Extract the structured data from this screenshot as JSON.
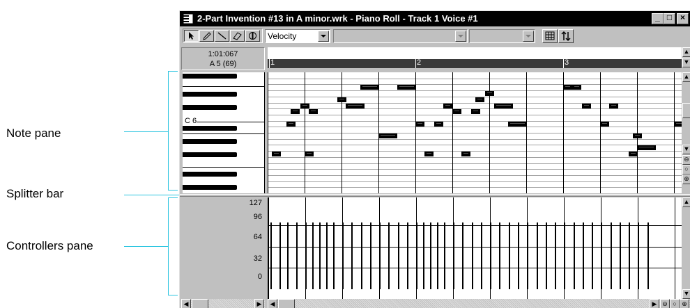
{
  "window": {
    "title": "2-Part Invention #13 in A minor.wrk - Piano Roll - Track 1 Voice #1",
    "min_glyph": "_",
    "max_glyph": "□",
    "close_glyph": "×"
  },
  "toolbar": {
    "tools": [
      "select-arrow-icon",
      "pencil-icon",
      "line-icon",
      "eraser-icon",
      "scrub-icon"
    ],
    "controller_select": "Velocity",
    "snap_icon": "grid-icon",
    "swap_icon": "arrows-updown-icon"
  },
  "position": {
    "time": "1:01:067",
    "pitch": "A 5 (69)"
  },
  "ruler": {
    "measures": [
      "1",
      "2",
      "3"
    ]
  },
  "keyboard": {
    "c_label": "C 6"
  },
  "controller_scale": [
    "127",
    "96",
    "64",
    "32",
    "0"
  ],
  "callouts": {
    "note_pane": "Note pane",
    "splitter_bar": "Splitter bar",
    "controllers_pane": "Controllers pane"
  },
  "colors": {
    "callout_line": "#29c4e0",
    "window_face": "#c0c0c0",
    "titlebar": "#000000",
    "ruler_bar": "#3a3a3a"
  },
  "notes": [
    {
      "start": 0.06,
      "len": 0.12,
      "row": 13
    },
    {
      "start": 0.31,
      "len": 0.12,
      "row": 6
    },
    {
      "start": 0.44,
      "len": 0.12,
      "row": 5
    },
    {
      "start": 0.56,
      "len": 0.12,
      "row": 6
    },
    {
      "start": 0.25,
      "len": 0.12,
      "row": 8
    },
    {
      "start": 0.5,
      "len": 0.12,
      "row": 13
    },
    {
      "start": 0.94,
      "len": 0.12,
      "row": 4
    },
    {
      "start": 1.25,
      "len": 0.25,
      "row": 2
    },
    {
      "start": 1.06,
      "len": 0.25,
      "row": 5
    },
    {
      "start": 1.5,
      "len": 0.25,
      "row": 10
    },
    {
      "start": 1.75,
      "len": 0.25,
      "row": 2
    },
    {
      "start": 2.0,
      "len": 0.12,
      "row": 8
    },
    {
      "start": 2.12,
      "len": 0.12,
      "row": 13
    },
    {
      "start": 2.25,
      "len": 0.12,
      "row": 8
    },
    {
      "start": 2.38,
      "len": 0.12,
      "row": 5
    },
    {
      "start": 2.5,
      "len": 0.12,
      "row": 6
    },
    {
      "start": 2.62,
      "len": 0.12,
      "row": 13
    },
    {
      "start": 2.75,
      "len": 0.12,
      "row": 6
    },
    {
      "start": 2.81,
      "len": 0.12,
      "row": 4
    },
    {
      "start": 2.94,
      "len": 0.12,
      "row": 3
    },
    {
      "start": 3.06,
      "len": 0.25,
      "row": 5
    },
    {
      "start": 3.25,
      "len": 0.25,
      "row": 8
    },
    {
      "start": 4.0,
      "len": 0.12,
      "row": 2
    },
    {
      "start": 4.12,
      "len": 0.12,
      "row": 2
    },
    {
      "start": 4.25,
      "len": 0.12,
      "row": 5
    },
    {
      "start": 4.5,
      "len": 0.12,
      "row": 8
    },
    {
      "start": 4.62,
      "len": 0.12,
      "row": 5
    },
    {
      "start": 4.88,
      "len": 0.12,
      "row": 13
    },
    {
      "start": 4.94,
      "len": 0.12,
      "row": 10
    },
    {
      "start": 5.0,
      "len": 0.25,
      "row": 12
    },
    {
      "start": 5.5,
      "len": 0.25,
      "row": 8
    },
    {
      "start": 5.62,
      "len": 0.12,
      "row": 4
    }
  ],
  "velocities": {
    "value": 100,
    "beats": [
      0.06,
      0.31,
      0.5,
      0.75,
      1.0,
      1.19,
      1.38,
      1.56,
      1.75,
      2.0,
      2.25,
      2.5,
      2.75,
      3.0,
      3.25,
      3.5,
      3.75,
      4.0,
      4.19,
      4.38,
      4.56,
      4.75,
      5.0,
      5.25,
      5.5,
      5.75,
      6.0,
      6.25,
      6.5,
      6.75,
      7.0,
      7.25,
      7.5,
      7.75,
      8.0,
      8.25,
      8.5,
      8.75,
      9.0,
      9.25,
      9.5,
      9.75,
      10.0,
      10.25
    ]
  }
}
